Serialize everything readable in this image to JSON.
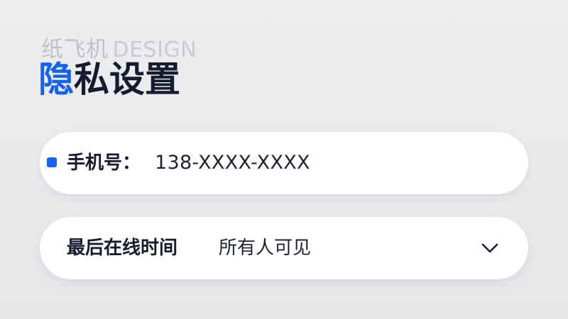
{
  "header": {
    "watermark_cn": "纸飞机",
    "watermark_en": "DESIGN",
    "title_accent": "隐",
    "title_rest": "私设置"
  },
  "phone_row": {
    "label": "手机号：",
    "value": "138-XXXX-XXXX"
  },
  "last_seen_row": {
    "label": "最后在线时间",
    "value": "所有人可见",
    "icon": "chevron-down-icon"
  },
  "colors": {
    "accent": "#1562f0",
    "text": "#151c30",
    "card_background": "#ffffff",
    "page_background": "#ebebed"
  }
}
